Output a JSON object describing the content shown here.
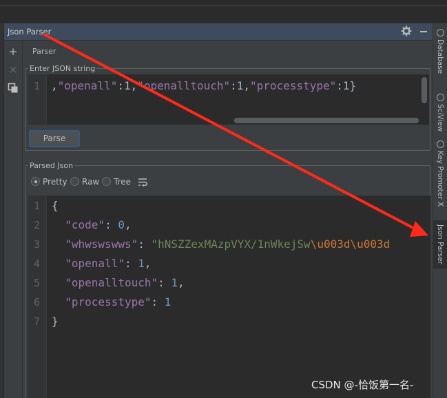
{
  "window": {
    "title": "Json Parser"
  },
  "toolbar": {
    "add": "+",
    "close": "×"
  },
  "tabs": [
    {
      "label": "Parser"
    }
  ],
  "input_group": {
    "legend": "Enter JSON string",
    "line_number": "1",
    "content": [
      {
        "text": ",",
        "k": "pun"
      },
      {
        "text": "\"openall\"",
        "k": "k2"
      },
      {
        "text": ":1,",
        "k": "pun"
      },
      {
        "text": "\"openalltouch\"",
        "k": "k2"
      },
      {
        "text": ":1,",
        "k": "pun"
      },
      {
        "text": "\"processtype\"",
        "k": "k2"
      },
      {
        "text": ":1}",
        "k": "pun"
      }
    ]
  },
  "parse_button": {
    "label": "Parse"
  },
  "output_group": {
    "legend": "Parsed Json",
    "view_modes": [
      {
        "label": "Pretty",
        "selected": true
      },
      {
        "label": "Raw",
        "selected": false
      },
      {
        "label": "Tree",
        "selected": false
      }
    ],
    "lines": [
      {
        "n": "1",
        "tokens": [
          {
            "t": "{",
            "k": "pun"
          }
        ]
      },
      {
        "n": "2",
        "tokens": [
          {
            "t": "  ",
            "k": "pun"
          },
          {
            "t": "\"code\"",
            "k": "key"
          },
          {
            "t": ": ",
            "k": "pun"
          },
          {
            "t": "0",
            "k": "num"
          },
          {
            "t": ",",
            "k": "pun"
          }
        ]
      },
      {
        "n": "3",
        "tokens": [
          {
            "t": "  ",
            "k": "pun"
          },
          {
            "t": "\"whwswswws\"",
            "k": "key"
          },
          {
            "t": ": ",
            "k": "pun"
          },
          {
            "t": "\"hNSZZexMAzpVYX/1nWkejSw",
            "k": "str"
          },
          {
            "t": "\\u003d\\u003d",
            "k": "esc"
          }
        ]
      },
      {
        "n": "4",
        "tokens": [
          {
            "t": "  ",
            "k": "pun"
          },
          {
            "t": "\"openall\"",
            "k": "key"
          },
          {
            "t": ": ",
            "k": "pun"
          },
          {
            "t": "1",
            "k": "num"
          },
          {
            "t": ",",
            "k": "pun"
          }
        ]
      },
      {
        "n": "5",
        "tokens": [
          {
            "t": "  ",
            "k": "pun"
          },
          {
            "t": "\"openalltouch\"",
            "k": "key"
          },
          {
            "t": ": ",
            "k": "pun"
          },
          {
            "t": "1",
            "k": "num"
          },
          {
            "t": ",",
            "k": "pun"
          }
        ]
      },
      {
        "n": "6",
        "tokens": [
          {
            "t": "  ",
            "k": "pun"
          },
          {
            "t": "\"processtype\"",
            "k": "key"
          },
          {
            "t": ": ",
            "k": "pun"
          },
          {
            "t": "1",
            "k": "num"
          }
        ]
      },
      {
        "n": "7",
        "tokens": [
          {
            "t": "}",
            "k": "pun"
          }
        ]
      }
    ]
  },
  "right_sidebar": [
    {
      "label": "Database",
      "active": false
    },
    {
      "label": "SciView",
      "active": false
    },
    {
      "label": "Key Promoter X",
      "active": false
    },
    {
      "label": "Json Parser",
      "active": true
    }
  ],
  "watermark": "CSDN @-恰饭第一名-",
  "annotation_color": "#ff2a1a"
}
